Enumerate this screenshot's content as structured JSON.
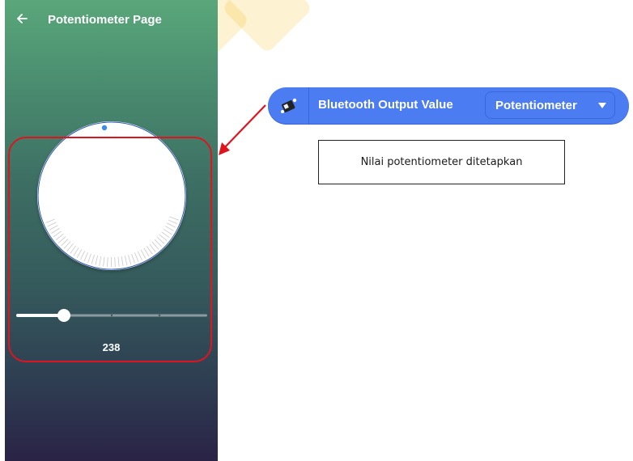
{
  "phone": {
    "title": "Potentiometer Page",
    "value": "238",
    "slider_fraction": 0.25
  },
  "block": {
    "label": "Bluetooth Output Value",
    "dropdown_value": "Potentiometer"
  },
  "caption": "Nilai potentiometer ditetapkan",
  "colors": {
    "block_blue": "#4c7cf2",
    "highlight_red": "#e0141e",
    "knob_dot": "#3b8de8"
  }
}
